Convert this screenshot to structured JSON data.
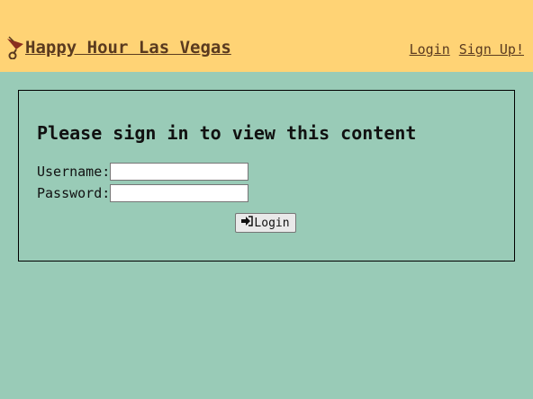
{
  "header": {
    "title": "Happy Hour Las Vegas",
    "logo_icon": "cocktail-glass-icon",
    "nav": [
      {
        "label": "Login"
      },
      {
        "label": "Sign Up!"
      }
    ],
    "background_color": "#ffd375",
    "link_color": "#5a3a1f"
  },
  "main": {
    "heading": "Please sign in to view this content",
    "username_label": "Username:",
    "username_value": "",
    "password_label": "Password:",
    "password_value": "",
    "login_button_label": "Login",
    "login_button_icon": "sign-in-icon",
    "background_color": "#99cbb7"
  }
}
